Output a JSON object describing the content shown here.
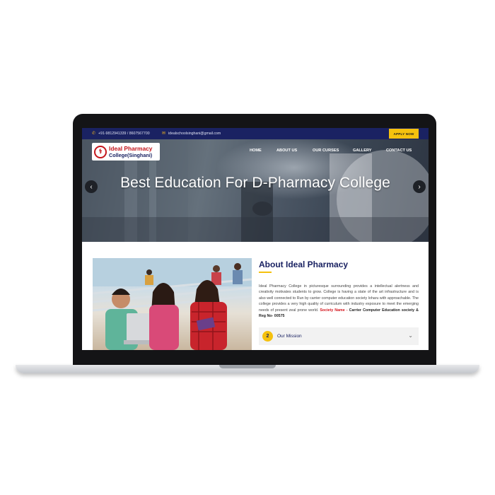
{
  "topbar": {
    "phone": "+91-9812941339 / 8607567700",
    "email": "idealschoolsinghani@gmail.com",
    "apply_label": "APPLY NOW"
  },
  "logo": {
    "line1": "Ideal Pharmacy",
    "line2": "College(Singhani)"
  },
  "nav": [
    {
      "label": "HOME"
    },
    {
      "label": "ABOUT US"
    },
    {
      "label": "OUR CURSES"
    },
    {
      "label": "GALLERY"
    },
    {
      "label": "CONTACT US"
    }
  ],
  "hero": {
    "title": "Best Education For D-Pharmacy College",
    "prev_icon": "‹",
    "next_icon": "›"
  },
  "about": {
    "title": "About Ideal Pharmacy",
    "body": "Ideal Pharmacy College in picturesque surrounding provides a intellectual alertness and creativity motivates students to grow. College is having a state of the art infrastructure and is also well connected to Run by carrier computer education society loharu with approachable. The college provides a very high quality of curriculum with industry exposure to meet the emerging needs of present zeal prone world.",
    "society_label": "Society Name -",
    "society_value": "Carrier Computer Education society & Reg No- 00575"
  },
  "mission": {
    "number": "2",
    "label": "Our Mission"
  },
  "colors": {
    "navy": "#1a2262",
    "accent": "#f5c10e",
    "red": "#d4141c"
  }
}
